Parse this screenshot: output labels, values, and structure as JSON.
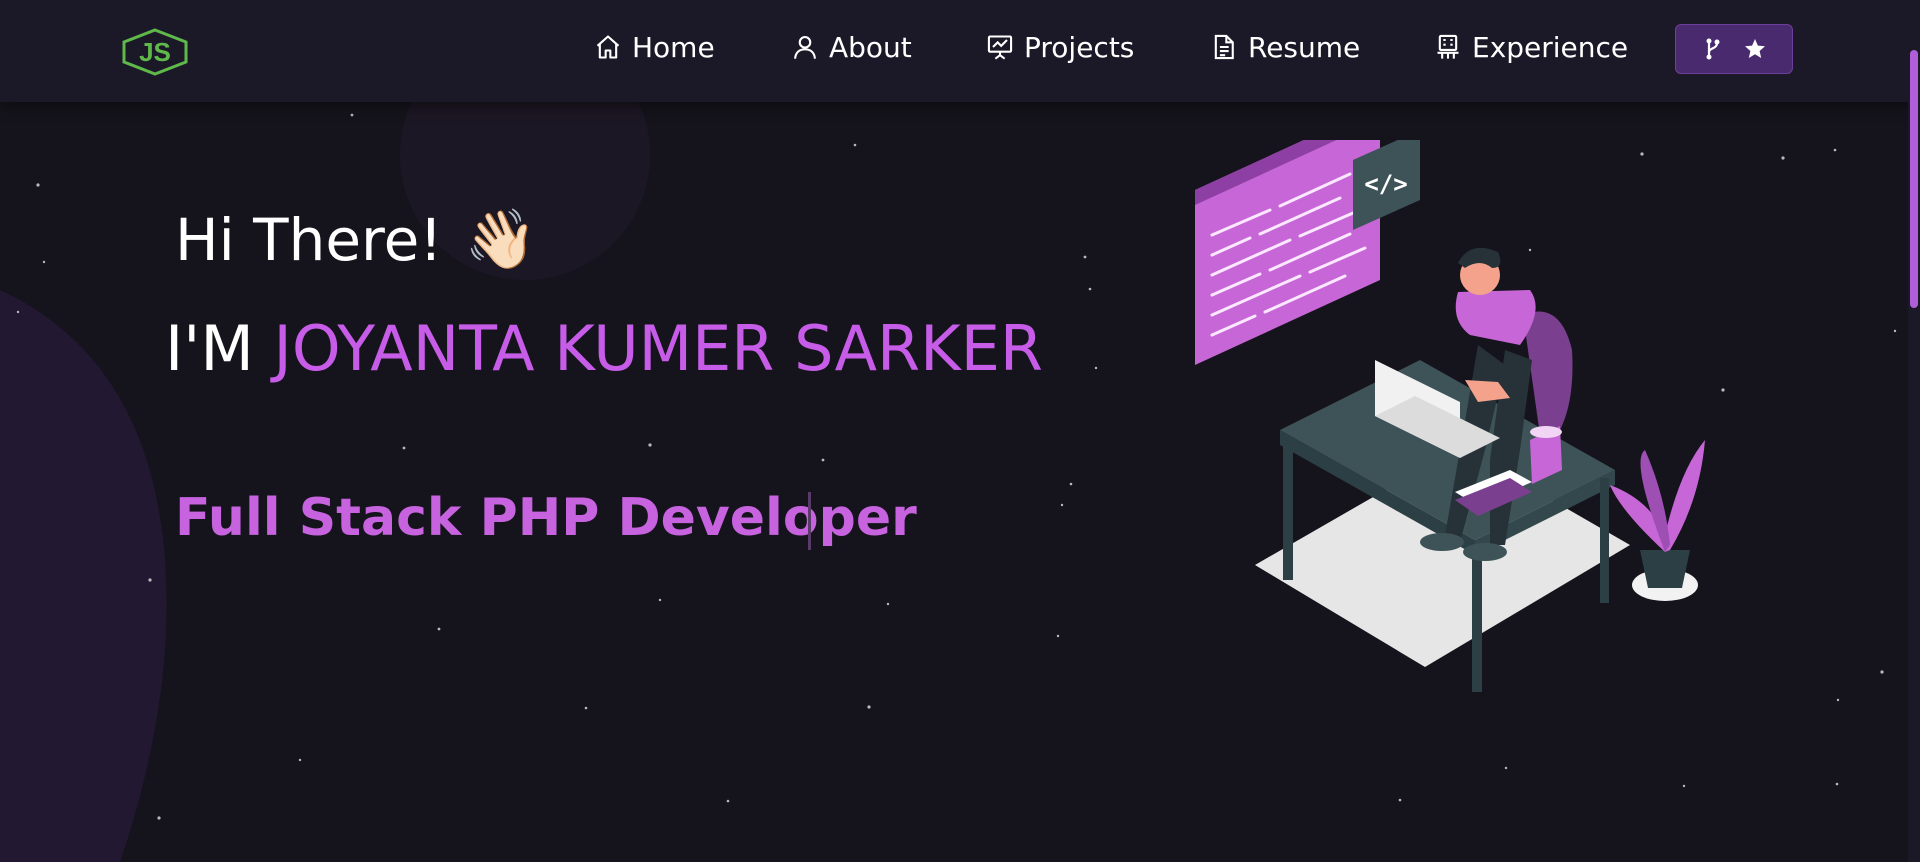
{
  "nav": {
    "items": [
      {
        "label": "Home",
        "icon": "home-icon"
      },
      {
        "label": "About",
        "icon": "user-icon"
      },
      {
        "label": "Projects",
        "icon": "presentation-icon"
      },
      {
        "label": "Resume",
        "icon": "document-icon"
      },
      {
        "label": "Experience",
        "icon": "building-icon"
      }
    ],
    "fork_button": {
      "icons": [
        "fork-icon",
        "star-icon"
      ]
    }
  },
  "hero": {
    "greeting": "Hi There!",
    "greeting_emoji": "👋🏻",
    "intro_prefix": "I'M",
    "name": "JOYANTA KUMER SARKER",
    "role": "Full Stack PHP Developer"
  },
  "colors": {
    "accent": "#c75ce8",
    "background": "#15141c",
    "navbar": "#1b1927",
    "logo_green": "#5fb94a"
  }
}
